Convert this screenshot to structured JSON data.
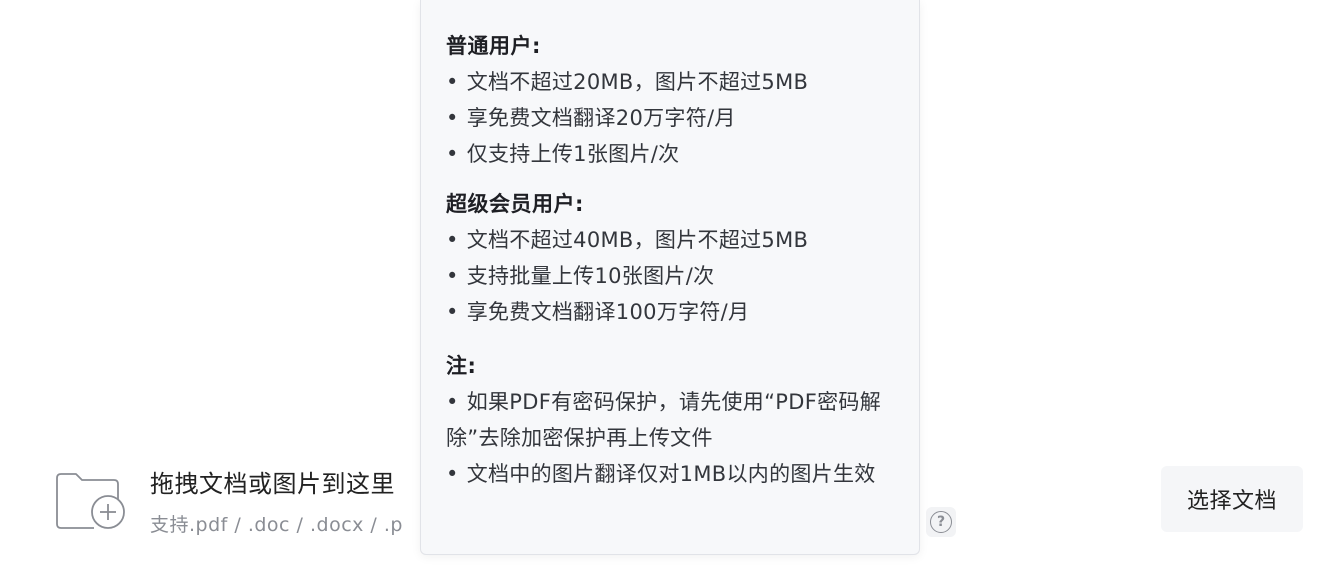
{
  "upload": {
    "title": "拖拽文档或图片到这里",
    "formats": "支持.pdf / .doc / .docx / .p",
    "select_button": "选择文档",
    "help_icon": "?"
  },
  "tooltip": {
    "sections": [
      {
        "heading": "普通用户:",
        "items": [
          "文档不超过20MB，图片不超过5MB",
          "享免费文档翻译20万字符/月",
          "仅支持上传1张图片/次"
        ]
      },
      {
        "heading": "超级会员用户:",
        "items": [
          "文档不超过40MB，图片不超过5MB",
          "支持批量上传10张图片/次",
          "享免费文档翻译100万字符/月"
        ]
      },
      {
        "heading": "注:",
        "items": [
          "如果PDF有密码保护，请先使用“PDF密码解除”去除加密保护再上传文件",
          "文档中的图片翻译仅对1MB以内的图片生效"
        ]
      }
    ]
  }
}
